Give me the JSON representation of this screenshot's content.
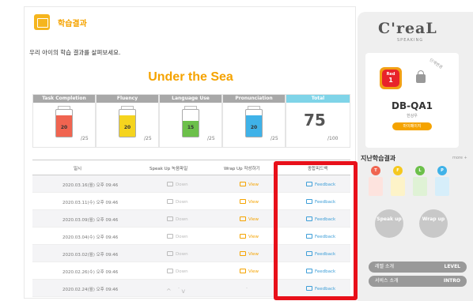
{
  "header": {
    "title": "학습결과",
    "subtitle": "우리 아이의 학습 결과를 살펴보세요."
  },
  "topic": "Under the Sea",
  "scores": [
    {
      "label": "Task Completion",
      "value": "20",
      "max": "/25",
      "color": "#f06450",
      "header_color": "#a0a0a0",
      "fill": 0.8
    },
    {
      "label": "Fluency",
      "value": "20",
      "max": "/25",
      "color": "#f5d41e",
      "header_color": "#a0a0a0",
      "fill": 0.8
    },
    {
      "label": "Language Use",
      "value": "15",
      "max": "/25",
      "color": "#6cc04a",
      "header_color": "#a0a0a0",
      "fill": 0.6
    },
    {
      "label": "Pronunciation",
      "value": "20",
      "max": "/25",
      "color": "#3fb2e8",
      "header_color": "#a0a0a0",
      "fill": 0.8
    }
  ],
  "total": {
    "label": "Total",
    "value": "75",
    "max": "/100",
    "header_color": "#7fd4e8"
  },
  "table": {
    "headers": [
      "일시",
      "Speak Up 녹음파일",
      "Wrap Up 작성하기",
      "종합피드백"
    ],
    "rows": [
      {
        "date": "2020.03.16(월) 오후 09:46",
        "down": "Down",
        "view": "View",
        "fb": "Feedback"
      },
      {
        "date": "2020.03.11(수) 오후 09:46",
        "down": "Down",
        "view": "View",
        "fb": "Feedback"
      },
      {
        "date": "2020.03.09(월) 오후 09:46",
        "down": "Down",
        "view": "View",
        "fb": "Feedback"
      },
      {
        "date": "2020.03.04(수) 오후 09:46",
        "down": "Down",
        "view": "View",
        "fb": "Feedback"
      },
      {
        "date": "2020.03.02(월) 오후 09:46",
        "down": "Down",
        "view": "View",
        "fb": "Feedback"
      },
      {
        "date": "2020.02.26(수) 오후 09:46",
        "down": "Down",
        "view": "View",
        "fb": "Feedback"
      },
      {
        "date": "2020.02.24(월) 오후 09:46",
        "down": "-",
        "view": "-",
        "fb": "Feedback"
      }
    ]
  },
  "pager": {
    "prev": "^",
    "next": "v"
  },
  "sidebar": {
    "logo": "C'reaL",
    "logo_sub": "SPEAKING",
    "change_label": "단계변경",
    "level": {
      "color_name": "Red",
      "number": "1"
    },
    "code": "DB-QA1",
    "name": "한상우",
    "mypage": "마이페이지",
    "past_title": "지난학습결과",
    "more": "more +",
    "tags": [
      {
        "letter": "T",
        "color": "#f06450"
      },
      {
        "letter": "F",
        "color": "#f5c81e"
      },
      {
        "letter": "L",
        "color": "#6cc04a"
      },
      {
        "letter": "P",
        "color": "#3fb2e8"
      }
    ],
    "speak": "Speak up",
    "wrap": "Wrap up",
    "level_intro": {
      "label": "레벨 소개",
      "tag": "LEVEL"
    },
    "service_intro": {
      "label": "서비스 소개",
      "tag": "INTRO"
    }
  }
}
